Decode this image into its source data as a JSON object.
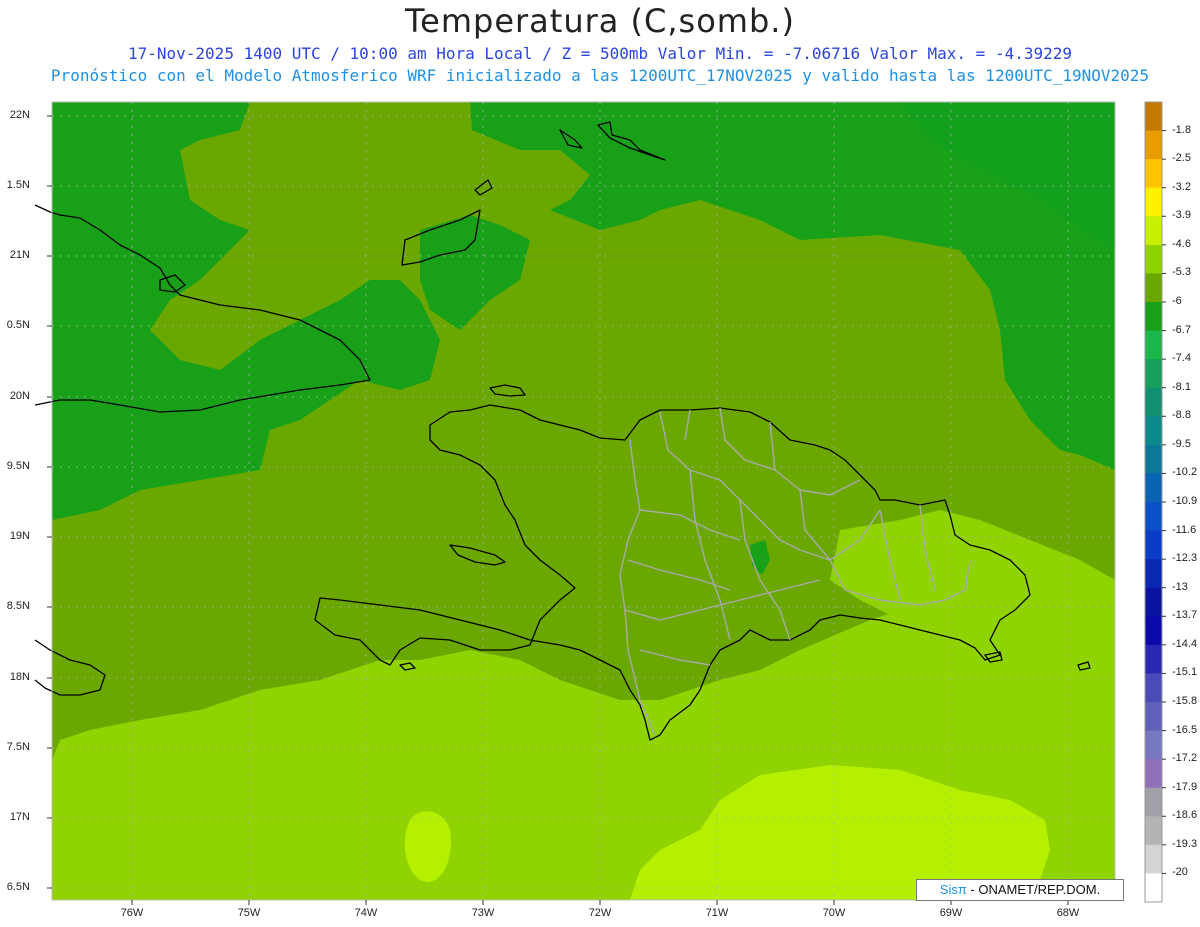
{
  "header": {
    "title": "Temperatura (C,somb.)",
    "subtitle1": "17-Nov-2025  1400 UTC / 10:00 am Hora Local / Z = 500mb  Valor Min. = -7.06716  Valor Max. = -4.39229",
    "subtitle2": "Pronóstico con el Modelo Atmosferico WRF inicializado a las 1200UTC_17NOV2025 y valido hasta las  1200UTC_19NOV2025"
  },
  "axes": {
    "lat_labels": [
      "22N",
      "1.5N",
      "21N",
      "0.5N",
      "20N",
      "9.5N",
      "19N",
      "8.5N",
      "18N",
      "7.5N",
      "17N",
      "6.5N"
    ],
    "lon_labels": [
      "76W",
      "75W",
      "74W",
      "73W",
      "72W",
      "71W",
      "70W",
      "69W",
      "68W"
    ]
  },
  "colorbar": {
    "labels": [
      "-1.8",
      "-2.5",
      "-3.2",
      "-3.9",
      "-4.6",
      "-5.3",
      "-6",
      "-6.7",
      "-7.4",
      "-8.1",
      "-8.8",
      "-9.5",
      "-10.2",
      "-10.9",
      "-11.6",
      "-12.3",
      "-13",
      "-13.7",
      "-14.4",
      "-15.1",
      "-15.8",
      "-16.5",
      "-17.2",
      "-17.9",
      "-18.6",
      "-19.3",
      "-20"
    ],
    "colors": [
      "#c47a00",
      "#e89c00",
      "#ffc400",
      "#fff200",
      "#c8f000",
      "#8fd400",
      "#6aa800",
      "#18a018",
      "#1ab84a",
      "#16a05a",
      "#10906e",
      "#0a8a8a",
      "#0a7896",
      "#0a64b4",
      "#0a50c8",
      "#0a3cc8",
      "#0a28b4",
      "#0a14a0",
      "#0a0aaa",
      "#2828b4",
      "#4a4ab8",
      "#6060b8",
      "#7878c0",
      "#9070b8",
      "#a0a0a8",
      "#b4b4b4",
      "#d4d4d4",
      "#ffffff"
    ]
  },
  "credit": {
    "brand": "Sisπ",
    "text": " - ONAMET/REP.DOM."
  },
  "fill_colors": {
    "ocean_mid": "#6aa800",
    "north_deep": "#18a018",
    "south_light": "#8fd400",
    "south_yellowgreen": "#b4f000",
    "coast": "#000000",
    "province": "#aaaaaa"
  }
}
